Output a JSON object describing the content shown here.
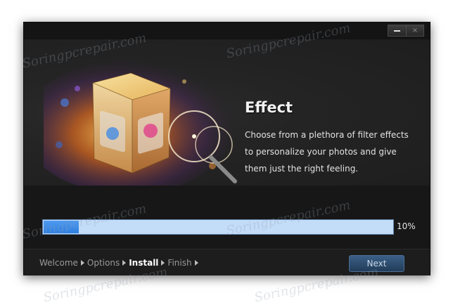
{
  "window": {
    "controls": {
      "minimize": "—",
      "close": "×"
    }
  },
  "feature": {
    "title": "Effect",
    "description": "Choose from a plethora of filter effects to personalize your photos and give them just the right feeling."
  },
  "progress": {
    "value": 0.1,
    "label": "10%"
  },
  "steps": [
    {
      "label": "Welcome",
      "active": false
    },
    {
      "label": "Options",
      "active": false
    },
    {
      "label": "Install",
      "active": true
    },
    {
      "label": "Finish",
      "active": false
    }
  ],
  "buttons": {
    "next": "Next"
  },
  "watermark": {
    "text": "Soringpcrepair.com"
  },
  "colors": {
    "progress_fill": "#3a86e8",
    "progress_track": "#c3dcf7",
    "next_button": "#2d4d70"
  }
}
